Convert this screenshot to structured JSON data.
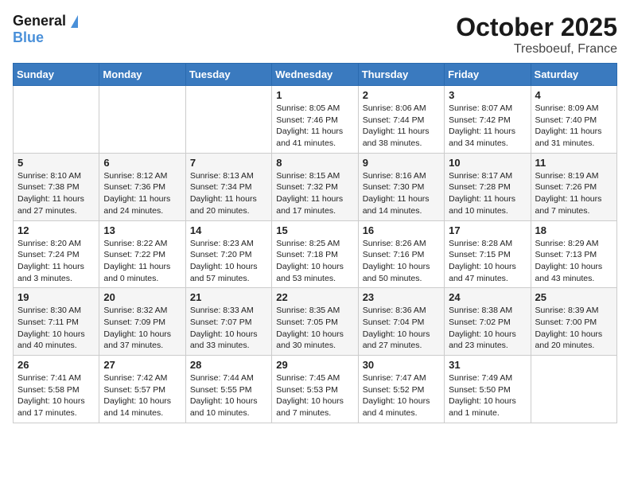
{
  "logo": {
    "general": "General",
    "blue": "Blue"
  },
  "title": "October 2025",
  "location": "Tresboeuf, France",
  "days_header": [
    "Sunday",
    "Monday",
    "Tuesday",
    "Wednesday",
    "Thursday",
    "Friday",
    "Saturday"
  ],
  "weeks": [
    [
      {
        "day": "",
        "info": ""
      },
      {
        "day": "",
        "info": ""
      },
      {
        "day": "",
        "info": ""
      },
      {
        "day": "1",
        "info": "Sunrise: 8:05 AM\nSunset: 7:46 PM\nDaylight: 11 hours\nand 41 minutes."
      },
      {
        "day": "2",
        "info": "Sunrise: 8:06 AM\nSunset: 7:44 PM\nDaylight: 11 hours\nand 38 minutes."
      },
      {
        "day": "3",
        "info": "Sunrise: 8:07 AM\nSunset: 7:42 PM\nDaylight: 11 hours\nand 34 minutes."
      },
      {
        "day": "4",
        "info": "Sunrise: 8:09 AM\nSunset: 7:40 PM\nDaylight: 11 hours\nand 31 minutes."
      }
    ],
    [
      {
        "day": "5",
        "info": "Sunrise: 8:10 AM\nSunset: 7:38 PM\nDaylight: 11 hours\nand 27 minutes."
      },
      {
        "day": "6",
        "info": "Sunrise: 8:12 AM\nSunset: 7:36 PM\nDaylight: 11 hours\nand 24 minutes."
      },
      {
        "day": "7",
        "info": "Sunrise: 8:13 AM\nSunset: 7:34 PM\nDaylight: 11 hours\nand 20 minutes."
      },
      {
        "day": "8",
        "info": "Sunrise: 8:15 AM\nSunset: 7:32 PM\nDaylight: 11 hours\nand 17 minutes."
      },
      {
        "day": "9",
        "info": "Sunrise: 8:16 AM\nSunset: 7:30 PM\nDaylight: 11 hours\nand 14 minutes."
      },
      {
        "day": "10",
        "info": "Sunrise: 8:17 AM\nSunset: 7:28 PM\nDaylight: 11 hours\nand 10 minutes."
      },
      {
        "day": "11",
        "info": "Sunrise: 8:19 AM\nSunset: 7:26 PM\nDaylight: 11 hours\nand 7 minutes."
      }
    ],
    [
      {
        "day": "12",
        "info": "Sunrise: 8:20 AM\nSunset: 7:24 PM\nDaylight: 11 hours\nand 3 minutes."
      },
      {
        "day": "13",
        "info": "Sunrise: 8:22 AM\nSunset: 7:22 PM\nDaylight: 11 hours\nand 0 minutes."
      },
      {
        "day": "14",
        "info": "Sunrise: 8:23 AM\nSunset: 7:20 PM\nDaylight: 10 hours\nand 57 minutes."
      },
      {
        "day": "15",
        "info": "Sunrise: 8:25 AM\nSunset: 7:18 PM\nDaylight: 10 hours\nand 53 minutes."
      },
      {
        "day": "16",
        "info": "Sunrise: 8:26 AM\nSunset: 7:16 PM\nDaylight: 10 hours\nand 50 minutes."
      },
      {
        "day": "17",
        "info": "Sunrise: 8:28 AM\nSunset: 7:15 PM\nDaylight: 10 hours\nand 47 minutes."
      },
      {
        "day": "18",
        "info": "Sunrise: 8:29 AM\nSunset: 7:13 PM\nDaylight: 10 hours\nand 43 minutes."
      }
    ],
    [
      {
        "day": "19",
        "info": "Sunrise: 8:30 AM\nSunset: 7:11 PM\nDaylight: 10 hours\nand 40 minutes."
      },
      {
        "day": "20",
        "info": "Sunrise: 8:32 AM\nSunset: 7:09 PM\nDaylight: 10 hours\nand 37 minutes."
      },
      {
        "day": "21",
        "info": "Sunrise: 8:33 AM\nSunset: 7:07 PM\nDaylight: 10 hours\nand 33 minutes."
      },
      {
        "day": "22",
        "info": "Sunrise: 8:35 AM\nSunset: 7:05 PM\nDaylight: 10 hours\nand 30 minutes."
      },
      {
        "day": "23",
        "info": "Sunrise: 8:36 AM\nSunset: 7:04 PM\nDaylight: 10 hours\nand 27 minutes."
      },
      {
        "day": "24",
        "info": "Sunrise: 8:38 AM\nSunset: 7:02 PM\nDaylight: 10 hours\nand 23 minutes."
      },
      {
        "day": "25",
        "info": "Sunrise: 8:39 AM\nSunset: 7:00 PM\nDaylight: 10 hours\nand 20 minutes."
      }
    ],
    [
      {
        "day": "26",
        "info": "Sunrise: 7:41 AM\nSunset: 5:58 PM\nDaylight: 10 hours\nand 17 minutes."
      },
      {
        "day": "27",
        "info": "Sunrise: 7:42 AM\nSunset: 5:57 PM\nDaylight: 10 hours\nand 14 minutes."
      },
      {
        "day": "28",
        "info": "Sunrise: 7:44 AM\nSunset: 5:55 PM\nDaylight: 10 hours\nand 10 minutes."
      },
      {
        "day": "29",
        "info": "Sunrise: 7:45 AM\nSunset: 5:53 PM\nDaylight: 10 hours\nand 7 minutes."
      },
      {
        "day": "30",
        "info": "Sunrise: 7:47 AM\nSunset: 5:52 PM\nDaylight: 10 hours\nand 4 minutes."
      },
      {
        "day": "31",
        "info": "Sunrise: 7:49 AM\nSunset: 5:50 PM\nDaylight: 10 hours\nand 1 minute."
      },
      {
        "day": "",
        "info": ""
      }
    ]
  ]
}
